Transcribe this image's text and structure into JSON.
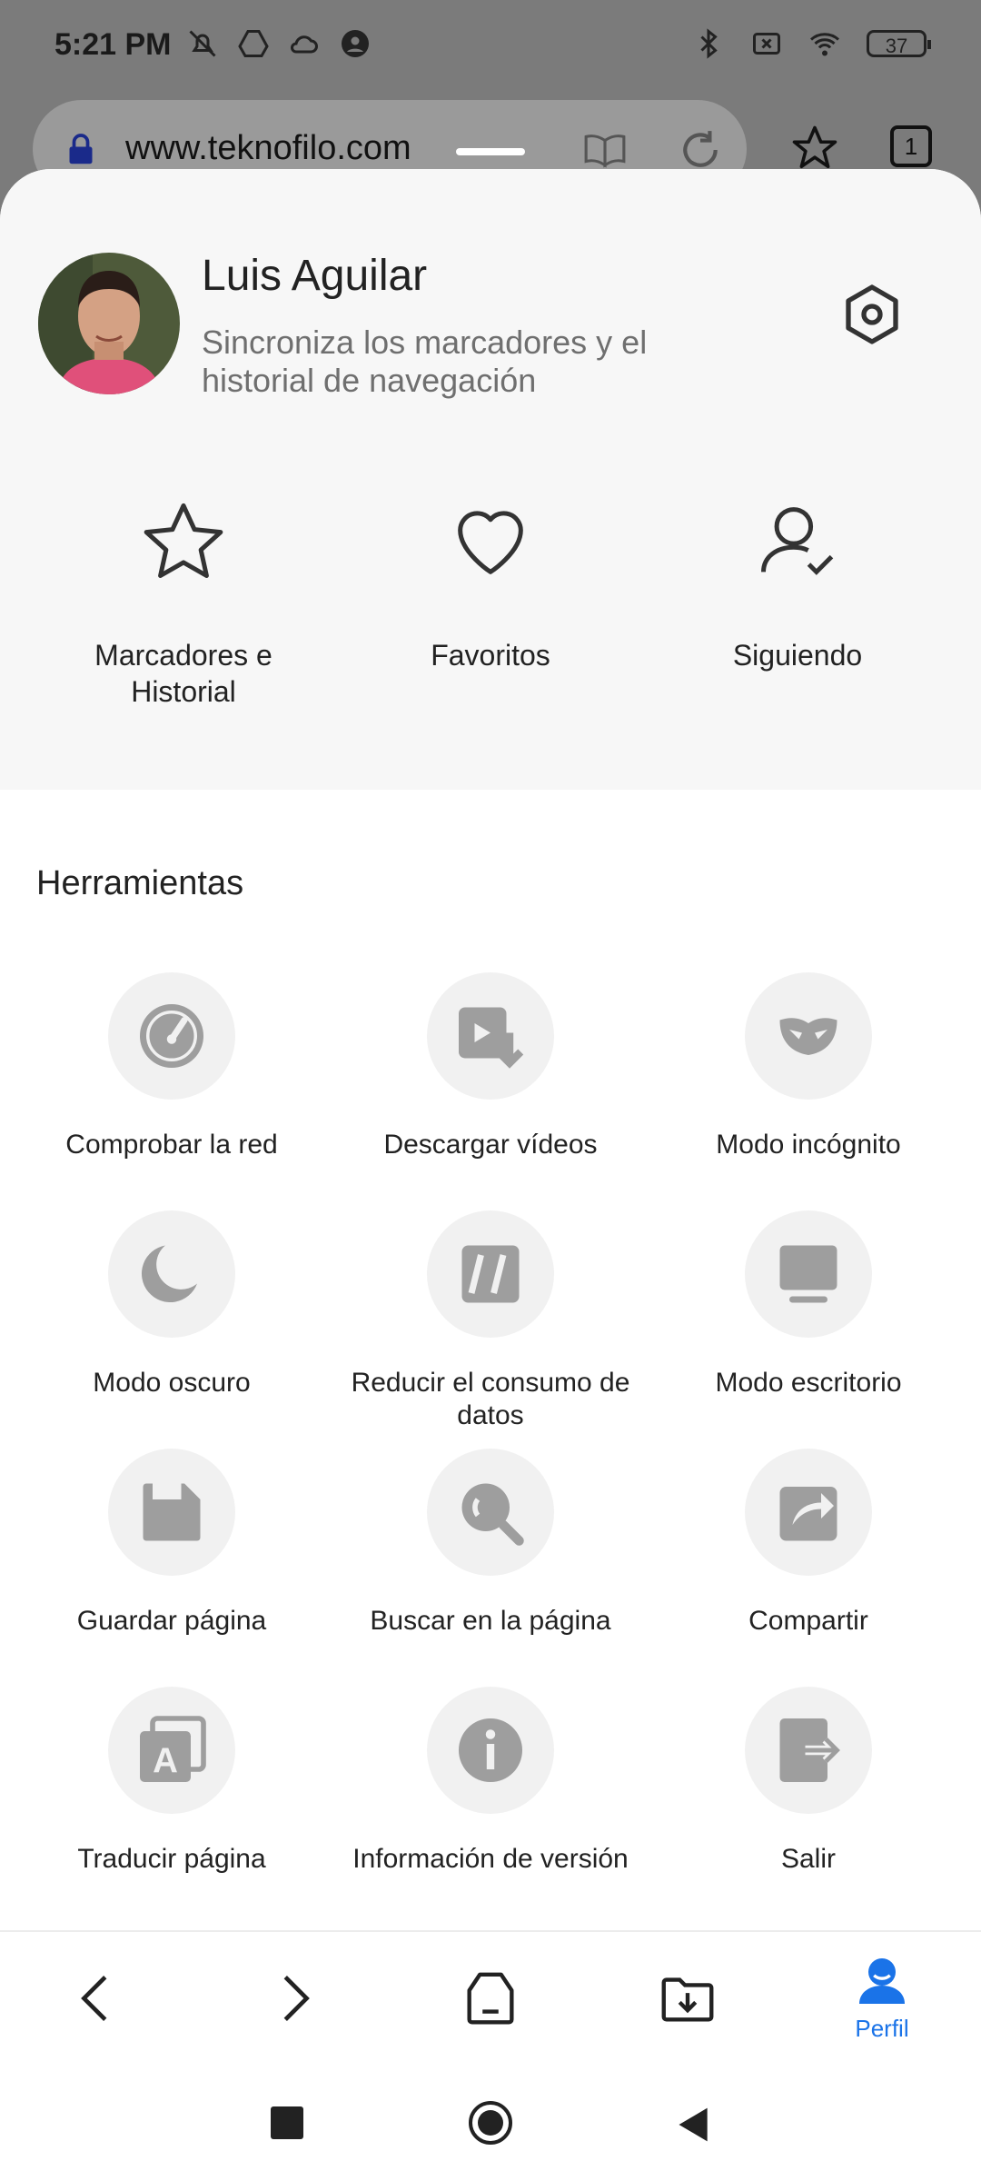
{
  "status": {
    "time": "5:21 PM",
    "battery": "37"
  },
  "browser": {
    "url": "www.teknofilo.com",
    "tab_count": "1"
  },
  "profile": {
    "name": "Luis Aguilar",
    "subtitle": "Sincroniza los marcadores y el historial de navegación"
  },
  "quick_actions": [
    {
      "label": "Marcadores e Historial",
      "icon": "star-icon"
    },
    {
      "label": "Favoritos",
      "icon": "heart-icon"
    },
    {
      "label": "Siguiendo",
      "icon": "user-check-icon"
    }
  ],
  "tools": {
    "title": "Herramientas",
    "items": [
      {
        "label": "Comprobar la red",
        "icon": "speedometer-icon"
      },
      {
        "label": "Descargar vídeos",
        "icon": "video-download-icon"
      },
      {
        "label": "Modo incógnito",
        "icon": "mask-icon"
      },
      {
        "label": "Modo oscuro",
        "icon": "moon-icon"
      },
      {
        "label": "Reducir el consumo de datos",
        "icon": "data-saver-icon"
      },
      {
        "label": "Modo escritorio",
        "icon": "desktop-icon"
      },
      {
        "label": "Guardar página",
        "icon": "save-icon"
      },
      {
        "label": "Buscar en la página",
        "icon": "search-icon"
      },
      {
        "label": "Compartir",
        "icon": "share-icon"
      },
      {
        "label": "Traducir página",
        "icon": "translate-icon"
      },
      {
        "label": "Información de versión",
        "icon": "info-icon"
      },
      {
        "label": "Salir",
        "icon": "exit-icon"
      }
    ]
  },
  "bottom_nav": {
    "profile_label": "Perfil"
  },
  "colors": {
    "accent": "#1a73e8",
    "tool_icon": "#9e9e9e",
    "circle_bg": "#f1f1f1"
  }
}
